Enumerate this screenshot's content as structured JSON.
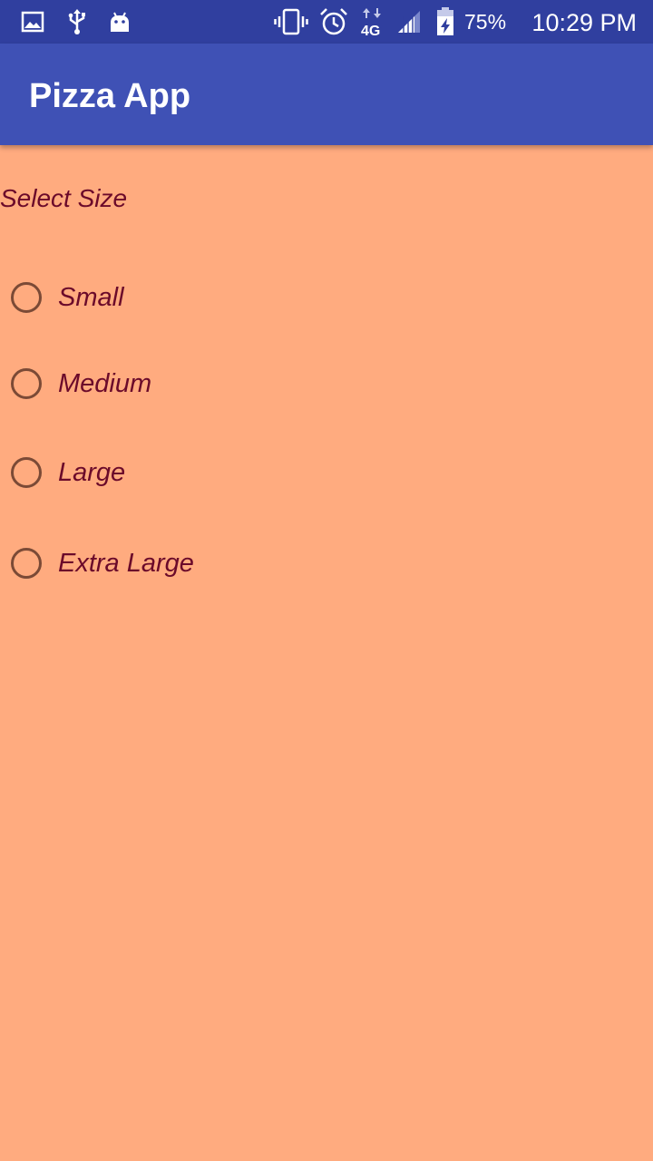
{
  "status_bar": {
    "left_icons": [
      "image-icon",
      "usb-icon",
      "android-icon"
    ],
    "right_icons": [
      "vibrate-icon",
      "alarm-icon",
      "network-4g-icon",
      "signal-icon",
      "battery-charging-icon"
    ],
    "network_type": "4G",
    "battery_percent": "75%",
    "time": "10:29 PM"
  },
  "app_bar": {
    "title": "Pizza App",
    "color": "#3f51b5"
  },
  "main": {
    "background_color": "#ffab7f",
    "section_label": "Select Size",
    "size_options": [
      {
        "label": "Small",
        "selected": false
      },
      {
        "label": "Medium",
        "selected": false
      },
      {
        "label": "Large",
        "selected": false
      },
      {
        "label": "Extra Large",
        "selected": false
      }
    ]
  }
}
